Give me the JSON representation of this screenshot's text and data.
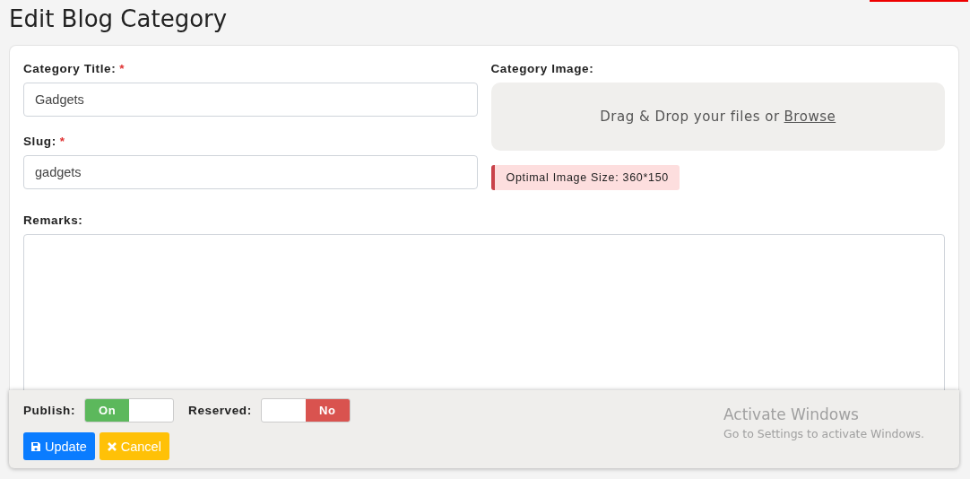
{
  "page": {
    "title": "Edit Blog Category"
  },
  "form": {
    "title_field": {
      "label": "Category Title:",
      "required_mark": "*",
      "value": "Gadgets"
    },
    "slug_field": {
      "label": "Slug:",
      "required_mark": "*",
      "value": "gadgets"
    },
    "image_field": {
      "label": "Category Image:",
      "drop_text": "Drag & Drop your files or",
      "browse_link": "Browse",
      "notice": "Optimal Image Size: 360*150"
    },
    "remarks_field": {
      "label": "Remarks:"
    }
  },
  "footer": {
    "toggles": [
      {
        "label": "Publish:",
        "on": true,
        "state_text": "On"
      },
      {
        "label": "Reserved:",
        "on": false,
        "state_text": "No"
      }
    ],
    "buttons": [
      {
        "kind": "primary",
        "label": "Update"
      },
      {
        "kind": "warning",
        "label": "Cancel"
      }
    ]
  },
  "os_notice": {
    "title": "Activate Windows",
    "subtitle": "Go to Settings to activate Windows."
  }
}
